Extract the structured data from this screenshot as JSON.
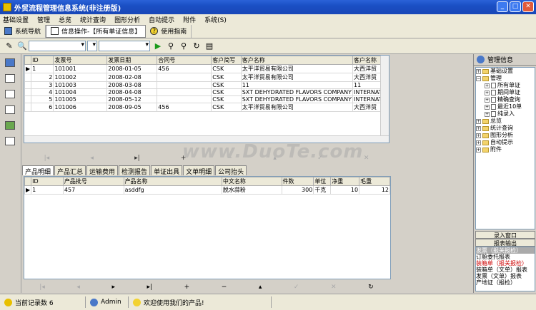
{
  "window": {
    "title": "外贸流程管理信息系统(非注册版)"
  },
  "menu": [
    "基础设置",
    "管理",
    "总览",
    "统计查询",
    "图形分析",
    "自动提示",
    "附件",
    "系统(S)"
  ],
  "tabs": [
    {
      "label": "系统导航"
    },
    {
      "label": "信息操作-【所有单证信息】"
    },
    {
      "label": "使用指南"
    }
  ],
  "grid1": {
    "columns": [
      "ID",
      "发票号",
      "发票日期",
      "合同号",
      "客户简写",
      "客户名称",
      "客户名称"
    ],
    "rows": [
      [
        "1",
        "101001",
        "2008-01-05",
        "456",
        "CSK",
        "太平洋贸易有限公司",
        "大西洋贸"
      ],
      [
        "2",
        "101002",
        "2008-02-08",
        "",
        "CSK",
        "太平洋贸易有限公司",
        "大西洋贸"
      ],
      [
        "3",
        "101003",
        "2008-03-08",
        "",
        "CSK",
        "11",
        "11"
      ],
      [
        "4",
        "101004",
        "2008-04-08",
        "",
        "CSK",
        "SXT DEHYDRATED FLAVORS COMPANY",
        "INTERNATI"
      ],
      [
        "5",
        "101005",
        "2008-05-12",
        "",
        "CSK",
        "SXT DEHYDRATED FLAVORS COMPANY",
        "INTERNATI"
      ],
      [
        "6",
        "101006",
        "2008-09-05",
        "456",
        "CSK",
        "太平洋贸易有限公司",
        "大西洋贸"
      ]
    ]
  },
  "subtabs": [
    "产品明细",
    "产品汇总",
    "运输费用",
    "检测报告",
    "单证出具",
    "文单明细",
    "公司抬头"
  ],
  "grid2": {
    "columns": [
      "ID",
      "产品批号",
      "产品名称",
      "中文名称",
      "件数",
      "单位",
      "净重",
      "毛重"
    ],
    "rows": [
      [
        "1",
        "457",
        "asddfg",
        "脱水蒜粉",
        "300",
        "千克",
        "10",
        "12"
      ]
    ]
  },
  "rightpanel": {
    "title": "管理信息",
    "tree": [
      {
        "label": "基础设置",
        "level": 0,
        "type": "folder"
      },
      {
        "label": "管理",
        "level": 0,
        "type": "folder"
      },
      {
        "label": "所有单证",
        "level": 1,
        "type": "doc"
      },
      {
        "label": "期间单证",
        "level": 1,
        "type": "doc"
      },
      {
        "label": "精确查询",
        "level": 1,
        "type": "doc"
      },
      {
        "label": "最近10单",
        "level": 1,
        "type": "doc"
      },
      {
        "label": "纯录入",
        "level": 1,
        "type": "doc"
      },
      {
        "label": "总览",
        "level": 0,
        "type": "folder"
      },
      {
        "label": "统计查询",
        "level": 0,
        "type": "folder"
      },
      {
        "label": "图形分析",
        "level": 0,
        "type": "folder"
      },
      {
        "label": "自动提示",
        "level": 0,
        "type": "folder"
      },
      {
        "label": "附件",
        "level": 0,
        "type": "folder"
      }
    ],
    "buttons": [
      "录入窗口",
      "报表输出"
    ],
    "reports": [
      "发票（报关报检）",
      "订舱委托报表",
      "装箱单（报关报检）",
      "装箱单（文单）报表",
      "发票（文单）报表",
      "产地证（报检）"
    ]
  },
  "status": {
    "record_count": "当前记录数 6",
    "user": "Admin",
    "welcome": "欢迎使用我们的产品!"
  },
  "watermark": "www.DuoTe.com"
}
